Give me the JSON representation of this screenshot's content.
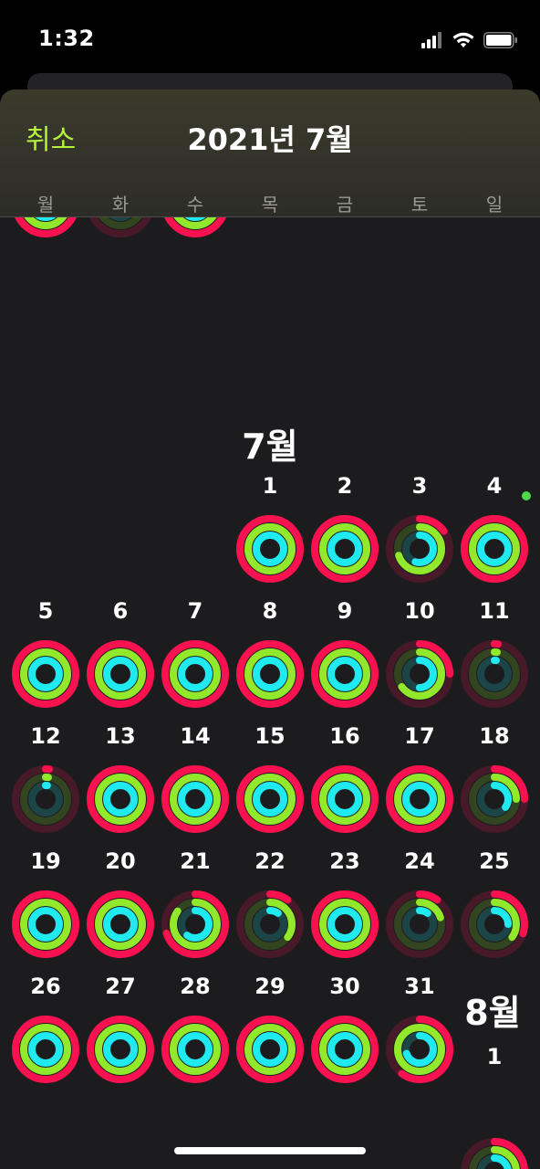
{
  "status": {
    "time": "1:32"
  },
  "header": {
    "cancel": "취소",
    "title": "2021년 7월"
  },
  "weekdays": [
    "월",
    "화",
    "수",
    "목",
    "금",
    "토",
    "일"
  ],
  "colors": {
    "move": "#fa114f",
    "exercise": "#92e82a",
    "stand": "#1eeaef",
    "accent": "#b6f23c"
  },
  "june_tail": [
    {
      "m": 1.0,
      "e": 1.0,
      "s": 1.0
    },
    {
      "m": 0.0,
      "e": 0.02,
      "s": 0.02
    },
    {
      "m": 1.0,
      "e": 1.0,
      "s": 1.0
    }
  ],
  "july": {
    "label": "7월",
    "days": [
      {
        "d": "1",
        "m": 1.0,
        "e": 1.0,
        "s": 1.0
      },
      {
        "d": "2",
        "m": 1.0,
        "e": 1.0,
        "s": 1.0
      },
      {
        "d": "3",
        "m": 0.15,
        "e": 0.7,
        "s": 0.55
      },
      {
        "d": "4",
        "m": 1.0,
        "e": 1.0,
        "s": 1.0,
        "dot": true
      },
      {
        "d": "5",
        "m": 1.0,
        "e": 1.0,
        "s": 1.0
      },
      {
        "d": "6",
        "m": 1.0,
        "e": 1.0,
        "s": 1.0
      },
      {
        "d": "7",
        "m": 1.0,
        "e": 1.0,
        "s": 1.0
      },
      {
        "d": "8",
        "m": 1.0,
        "e": 1.0,
        "s": 1.0
      },
      {
        "d": "9",
        "m": 1.0,
        "e": 1.0,
        "s": 1.0
      },
      {
        "d": "10",
        "m": 0.25,
        "e": 0.65,
        "s": 0.5
      },
      {
        "d": "11",
        "m": 0.02,
        "e": 0.02,
        "s": 0.02
      },
      {
        "d": "12",
        "m": 0.02,
        "e": 0.02,
        "s": 0.02
      },
      {
        "d": "13",
        "m": 1.0,
        "e": 1.0,
        "s": 1.0
      },
      {
        "d": "14",
        "m": 1.0,
        "e": 1.0,
        "s": 1.0
      },
      {
        "d": "15",
        "m": 1.0,
        "e": 1.0,
        "s": 1.0
      },
      {
        "d": "16",
        "m": 1.0,
        "e": 1.0,
        "s": 1.0
      },
      {
        "d": "17",
        "m": 1.0,
        "e": 1.0,
        "s": 1.0
      },
      {
        "d": "18",
        "m": 0.25,
        "e": 0.25,
        "s": 0.35
      },
      {
        "d": "19",
        "m": 1.0,
        "e": 1.0,
        "s": 1.0
      },
      {
        "d": "20",
        "m": 1.0,
        "e": 1.0,
        "s": 1.0
      },
      {
        "d": "21",
        "m": 0.7,
        "e": 0.85,
        "s": 0.6
      },
      {
        "d": "22",
        "m": 0.1,
        "e": 0.35,
        "s": 0.1
      },
      {
        "d": "23",
        "m": 1.0,
        "e": 1.0,
        "s": 1.0
      },
      {
        "d": "24",
        "m": 0.1,
        "e": 0.2,
        "s": 0.1
      },
      {
        "d": "25",
        "m": 0.3,
        "e": 0.35,
        "s": 0.25
      },
      {
        "d": "26",
        "m": 1.0,
        "e": 1.0,
        "s": 1.0
      },
      {
        "d": "27",
        "m": 1.0,
        "e": 1.0,
        "s": 1.0
      },
      {
        "d": "28",
        "m": 1.0,
        "e": 1.0,
        "s": 1.0
      },
      {
        "d": "29",
        "m": 1.0,
        "e": 1.0,
        "s": 1.0
      },
      {
        "d": "30",
        "m": 1.0,
        "e": 1.0,
        "s": 1.0
      },
      {
        "d": "31",
        "m": 0.6,
        "e": 1.0,
        "s": 0.7
      }
    ]
  },
  "august": {
    "label": "8월",
    "days": [
      {
        "d": "1",
        "m": 0.3,
        "e": 0.4,
        "s": 0.5
      }
    ]
  }
}
